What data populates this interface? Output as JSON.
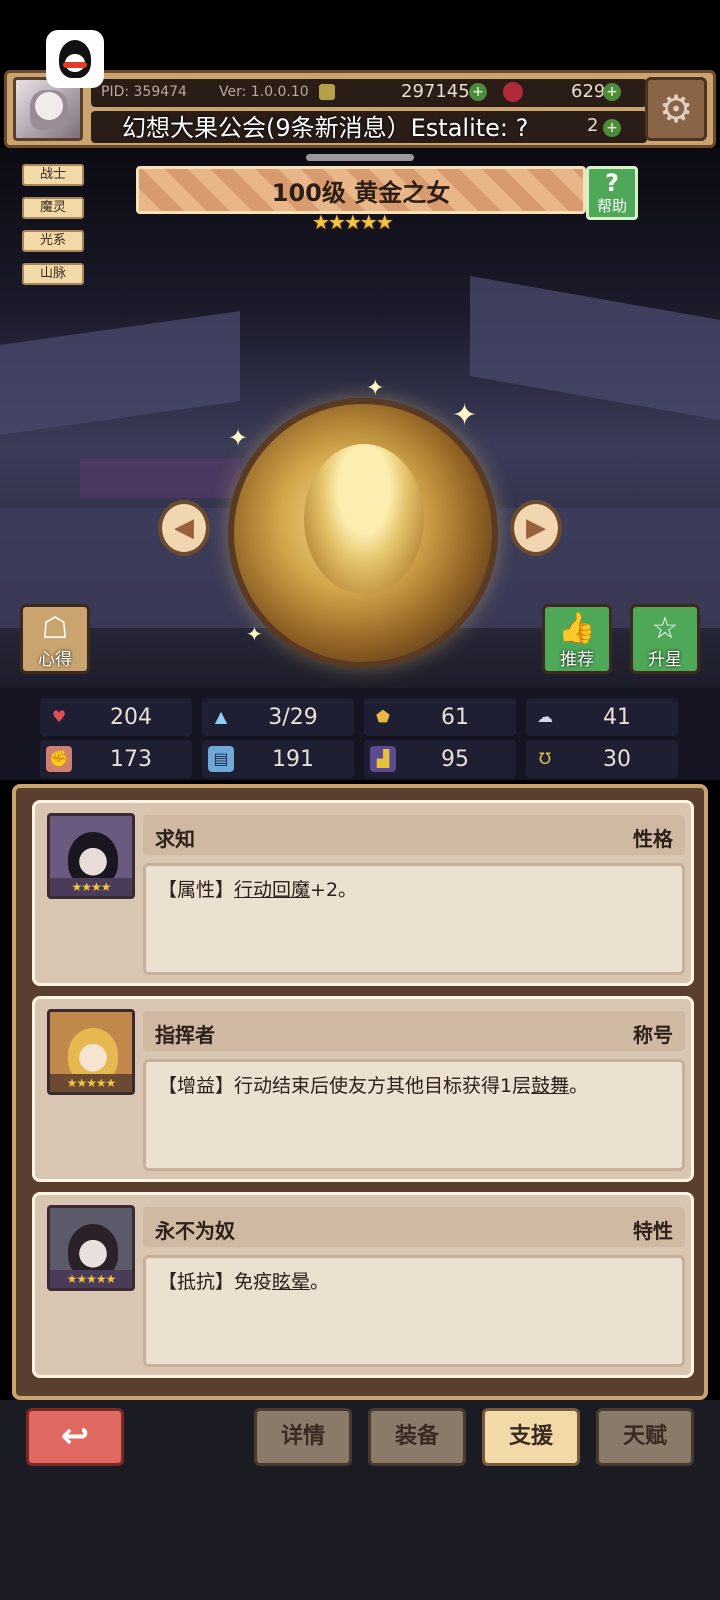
{
  "header": {
    "pid": "PID: 359474",
    "version": "Ver: 1.0.0.10",
    "gold": "297145",
    "gems": "629",
    "secondary_count": "2",
    "notification": "幻想大果公会(9条新消息）Estalite: ?"
  },
  "tags": [
    "战士",
    "魔灵",
    "光系",
    "山脉"
  ],
  "character": {
    "title": "100级  黄金之女",
    "stars": "★★★★★"
  },
  "buttons": {
    "help": "帮助",
    "insight": "心得",
    "recommend": "推荐",
    "upgrade_star": "升星"
  },
  "stats": [
    {
      "icon": "heart-icon",
      "value": "204"
    },
    {
      "icon": "mana-drop-icon",
      "value": "3/29"
    },
    {
      "icon": "shield-icon",
      "value": "61"
    },
    {
      "icon": "wing-icon",
      "value": "41"
    },
    {
      "icon": "fist-icon",
      "value": "173"
    },
    {
      "icon": "book-icon",
      "value": "191"
    },
    {
      "icon": "boot-icon",
      "value": "95"
    },
    {
      "icon": "horseshoe-icon",
      "value": "30"
    }
  ],
  "cards": [
    {
      "title": "求知",
      "type": "性格",
      "desc_prefix": "【属性】",
      "desc_link": "行动回魔",
      "desc_suffix": "+2。",
      "stars": "★★★★"
    },
    {
      "title": "指挥者",
      "type": "称号",
      "desc_prefix": "【增益】行动结束后使友方其他目标获得1层",
      "desc_link": "鼓舞",
      "desc_suffix": "。",
      "stars": "★★★★★"
    },
    {
      "title": "永不为奴",
      "type": "特性",
      "desc_prefix": "【抵抗】免疫",
      "desc_link": "眩晕",
      "desc_suffix": "。",
      "stars": "★★★★★"
    }
  ],
  "tabs": {
    "details": "详情",
    "equipment": "装备",
    "support": "支援",
    "talent": "天赋"
  },
  "colors": {
    "accent_gold": "#f3c440",
    "panel_brown": "#5a3e30",
    "help_green": "#4ea858",
    "back_red": "#e06a62"
  }
}
